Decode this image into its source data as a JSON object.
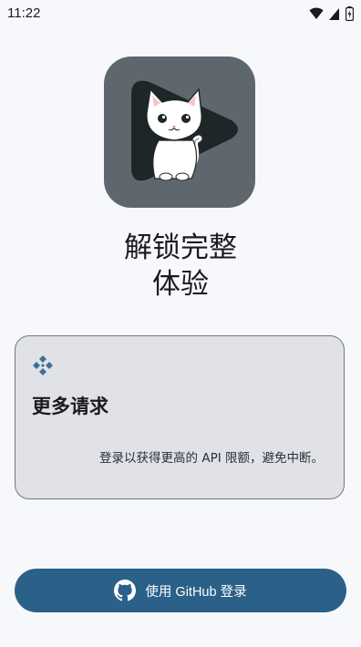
{
  "status_bar": {
    "time": "11:22",
    "icons": [
      "wifi-icon",
      "signal-icon",
      "battery-icon"
    ]
  },
  "app_icon": {
    "name": "cat-play-logo",
    "colors": {
      "background": "#5e676d",
      "play_triangle": "#1e2628",
      "cat": "#ffffff"
    }
  },
  "headline": {
    "line1": "解锁完整",
    "line2": "体验"
  },
  "feature_card": {
    "icon": "kodi-icon",
    "title": "更多请求",
    "description": "登录以获得更高的 API 限额，避免中断。"
  },
  "login_button": {
    "icon": "github-icon",
    "label": "使用 GitHub 登录"
  },
  "colors": {
    "page_background": "#f7f8fc",
    "card_background": "#e1e2e8",
    "card_border": "#73777f",
    "button_background": "#2b6089",
    "button_text": "#ffffff",
    "accent_icon": "#3f6f94"
  }
}
